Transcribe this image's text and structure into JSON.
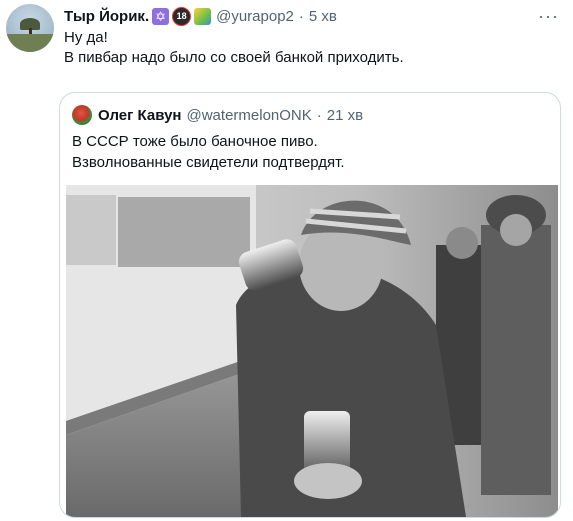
{
  "tweet": {
    "author_name": "Тыр Йорик.",
    "badges": [
      "star-of-david-emoji",
      "no-under-18-emoji",
      "picture-emoji"
    ],
    "handle": "@yurapop2",
    "separator": "·",
    "time": "5 хв",
    "text_lines": [
      "Ну да!",
      "В пивбар надо было со своей банкой приходить."
    ],
    "more_label": "···"
  },
  "quote": {
    "author_name": "Олег Кавун",
    "handle": "@watermelonONK",
    "separator": "·",
    "time": "21 хв",
    "text_lines": [
      "В СССР тоже было баночное пиво.",
      "Взволнованные свидетели подтвердят."
    ],
    "photo_icon": "black-and-white-photo"
  },
  "colors": {
    "text_primary": "#0f1419",
    "text_secondary": "#536471",
    "border": "#cfd9de"
  }
}
